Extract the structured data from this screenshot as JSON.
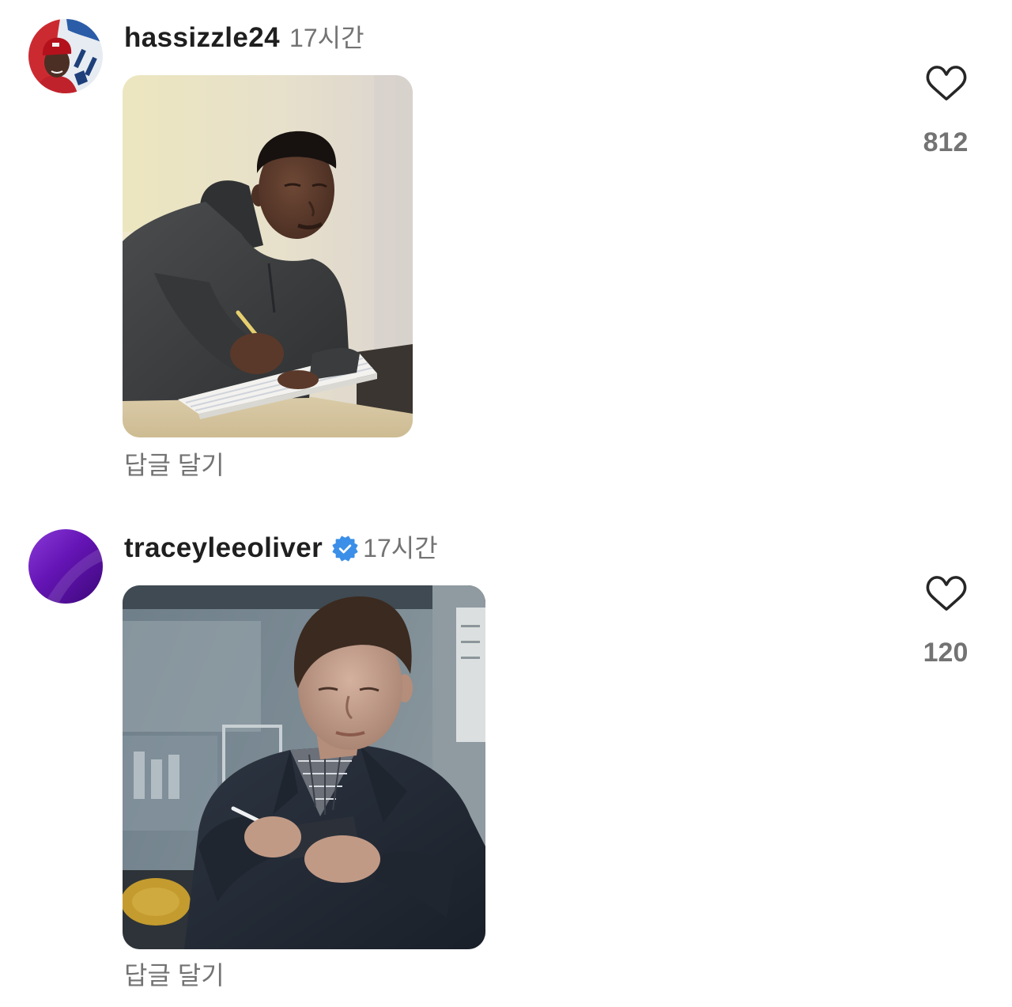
{
  "comments": [
    {
      "username": "hassizzle24",
      "verified": false,
      "time_ago": "17시간",
      "reply_label": "답글 달기",
      "like_count": "812"
    },
    {
      "username": "traceyleeoliver",
      "verified": true,
      "time_ago": "17시간",
      "reply_label": "답글 달기",
      "like_count": "120"
    }
  ],
  "icons": {
    "like": "heart-outline-icon",
    "verified": "verified-badge-icon"
  },
  "colors": {
    "username": "#1f1f1f",
    "secondary_text": "#737373",
    "verified_blue": "#3b8fe8",
    "heart_stroke": "#262626",
    "background": "#ffffff"
  }
}
